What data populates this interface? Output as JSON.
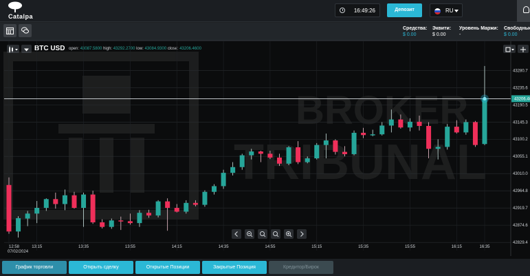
{
  "app": {
    "logo_text": "Catalpa"
  },
  "header": {
    "time": "16:49:26",
    "deposit_label": "Депозит",
    "language": "RU"
  },
  "account": {
    "funds_label": "Средства:",
    "funds_value": "$ 0.00",
    "equity_label": "Эквити:",
    "equity_value": "$ 0.00",
    "margin_label": "Уровень Маржи:",
    "margin_value": "-",
    "free_label": "Свободные",
    "free_value": "$ 0.00"
  },
  "chart_header": {
    "symbol": "BTC USD",
    "open_label": "open:",
    "open": "43087.5800",
    "high_label": "high:",
    "high": "43292.2700",
    "low_label": "low:",
    "low": "43084.9300",
    "close_label": "close:",
    "close": "43206.4600"
  },
  "bottom_tabs": [
    {
      "label": "График торговли"
    },
    {
      "label": "Открыть сделку"
    },
    {
      "label": "Открытые Позиции"
    },
    {
      "label": "Закрытые Позиция"
    },
    {
      "label": "Кредитор/Бирок"
    }
  ],
  "watermark": {
    "line1": "BROKER",
    "line2": "TRIBUNAL"
  },
  "colors": {
    "up": "#26a69a",
    "down": "#ef2f5a",
    "accent": "#2bb8d6",
    "price_tag": "#26a69a"
  },
  "chart_data": {
    "type": "candlestick",
    "y_ticks": [
      42829.4,
      42874.6,
      42919.7,
      42964.8,
      43010.0,
      43055.1,
      43100.2,
      43145.3,
      43190.5,
      43235.6,
      43280.7
    ],
    "y_tick_labels": [
      "42829.4",
      "42874.6",
      "42919.7",
      "42964.8",
      "43010.0",
      "43055.1",
      "43100.2",
      "43145.3",
      "43190.5",
      "43235.6",
      "43280.7"
    ],
    "ylim": [
      42808,
      43312
    ],
    "x_ticks": [
      "12:58",
      "13:15",
      "13:35",
      "13:55",
      "14:15",
      "14:35",
      "14:55",
      "15:15",
      "15:35",
      "15:55",
      "16:15",
      "16:35"
    ],
    "x_date": "07/02/2024",
    "current_price_label": "43206.46",
    "current_price": 43206.46,
    "candles": [
      [
        42980,
        43000,
        42852,
        42858
      ],
      [
        42858,
        42898,
        42842,
        42893
      ],
      [
        42892,
        42912,
        42872,
        42905
      ],
      [
        42905,
        42938,
        42880,
        42920
      ],
      [
        42920,
        42945,
        42912,
        42943
      ],
      [
        42943,
        42960,
        42918,
        42930
      ],
      [
        42930,
        42968,
        42914,
        42953
      ],
      [
        42953,
        42962,
        42918,
        42920
      ],
      [
        42920,
        42960,
        42870,
        42955
      ],
      [
        42955,
        42965,
        42878,
        42882
      ],
      [
        42882,
        42890,
        42866,
        42870
      ],
      [
        42870,
        42892,
        42865,
        42887
      ],
      [
        42887,
        42897,
        42862,
        42885
      ],
      [
        42885,
        42905,
        42876,
        42880
      ],
      [
        42880,
        42914,
        42870,
        42907
      ],
      [
        42907,
        42915,
        42894,
        42900
      ],
      [
        42900,
        42940,
        42895,
        42937
      ],
      [
        42937,
        42945,
        42860,
        42920
      ],
      [
        42920,
        42930,
        42908,
        42910
      ],
      [
        42910,
        42940,
        42905,
        42933
      ],
      [
        42933,
        42940,
        42924,
        42928
      ],
      [
        42928,
        42966,
        42923,
        42962
      ],
      [
        42962,
        42982,
        42955,
        42977
      ],
      [
        42977,
        43020,
        42970,
        43012
      ],
      [
        43012,
        43040,
        43005,
        43027
      ],
      [
        43027,
        43062,
        43020,
        43058
      ],
      [
        43058,
        43075,
        43047,
        43068
      ],
      [
        43068,
        43070,
        43040,
        43062
      ],
      [
        43062,
        43070,
        43048,
        43052
      ],
      [
        43052,
        43062,
        43030,
        43036
      ],
      [
        43036,
        43082,
        43032,
        43079
      ],
      [
        43079,
        43095,
        43035,
        43040
      ],
      [
        43040,
        43055,
        43037,
        43050
      ],
      [
        43050,
        43090,
        43047,
        43085
      ],
      [
        43085,
        43115,
        43050,
        43097
      ],
      [
        43097,
        43100,
        43060,
        43067
      ],
      [
        43067,
        43082,
        43055,
        43061
      ],
      [
        43061,
        43123,
        43058,
        43117
      ],
      [
        43117,
        43130,
        43103,
        43111
      ],
      [
        43111,
        43125,
        43108,
        43113
      ],
      [
        43113,
        43145,
        43110,
        43136
      ],
      [
        43136,
        43178,
        43118,
        43152
      ],
      [
        43152,
        43165,
        43128,
        43131
      ],
      [
        43131,
        43155,
        43121,
        43146
      ],
      [
        43146,
        43162,
        43123,
        43135
      ],
      [
        43135,
        43145,
        43050,
        43075
      ],
      [
        43075,
        43100,
        43047,
        43080
      ],
      [
        43080,
        43140,
        43073,
        43133
      ],
      [
        43133,
        43150,
        43115,
        43118
      ],
      [
        43118,
        43152,
        43112,
        43145
      ],
      [
        43145,
        43148,
        43080,
        43085
      ],
      [
        43087.58,
        43292.27,
        43084.93,
        43206.46
      ]
    ]
  }
}
